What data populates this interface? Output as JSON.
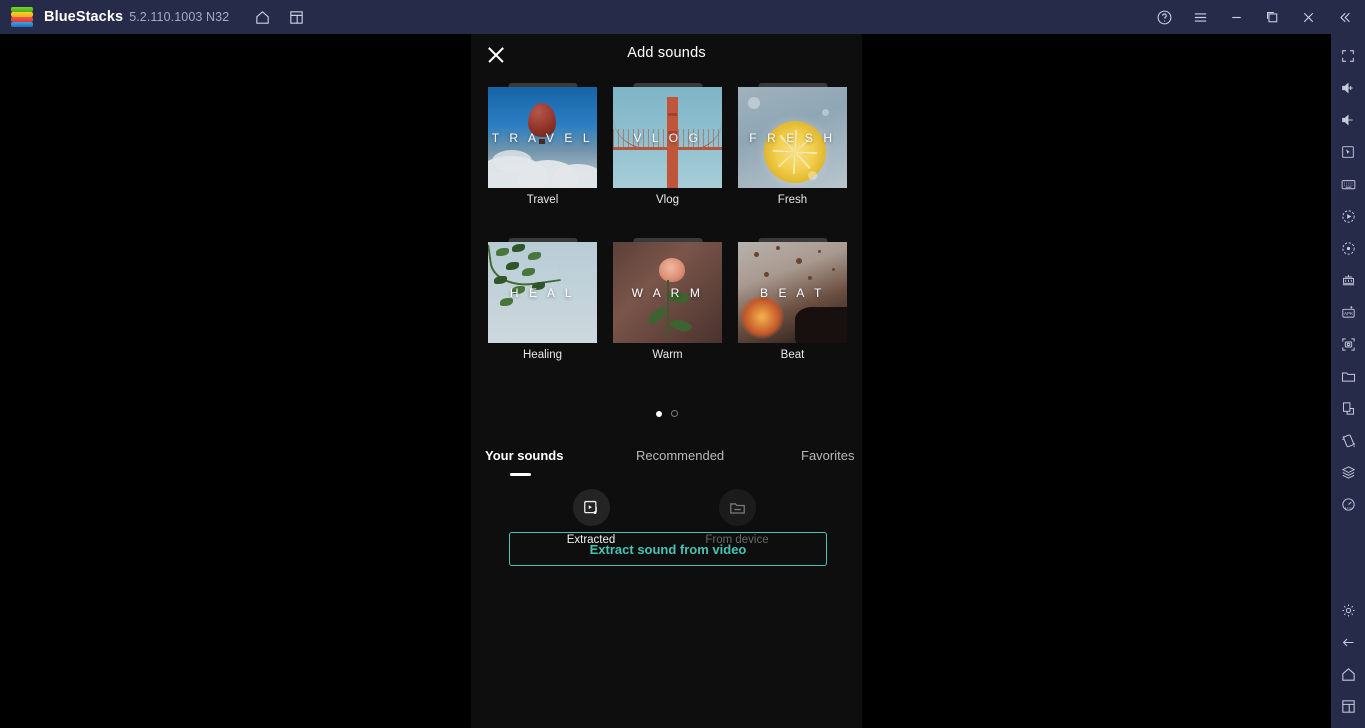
{
  "titlebar": {
    "app_name": "BlueStacks",
    "version": "5.2.110.1003 N32",
    "left_icons": [
      {
        "name": "home-icon",
        "glyph": "home"
      },
      {
        "name": "multi-instance-icon",
        "glyph": "windows"
      }
    ],
    "right_icons": [
      {
        "name": "help-icon",
        "glyph": "help"
      },
      {
        "name": "menu-icon",
        "glyph": "hamburger"
      },
      {
        "name": "minimize-icon",
        "glyph": "minimize"
      },
      {
        "name": "maximize-icon",
        "glyph": "maximize"
      },
      {
        "name": "close-icon",
        "glyph": "close"
      },
      {
        "name": "collapse-sidebar-icon",
        "glyph": "chevrons-left"
      }
    ]
  },
  "sidebar": {
    "top_items": [
      {
        "name": "fullscreen-icon",
        "label": "Fullscreen"
      },
      {
        "name": "volume-up-icon",
        "label": "Volume up"
      },
      {
        "name": "volume-down-icon",
        "label": "Volume down"
      },
      {
        "name": "cursor-icon",
        "label": "Game controls"
      },
      {
        "name": "keyboard-icon",
        "label": "Keyboard controls"
      },
      {
        "name": "record-icon",
        "label": "Record"
      },
      {
        "name": "rotate-icon",
        "label": "Rotate"
      },
      {
        "name": "multi-instance-manager-icon",
        "label": "Multi-instance manager"
      },
      {
        "name": "install-apk-icon",
        "label": "Install APK"
      },
      {
        "name": "screenshot-icon",
        "label": "Screenshot"
      },
      {
        "name": "media-folder-icon",
        "label": "Media manager"
      },
      {
        "name": "copy-paste-icon",
        "label": "Copy to clipboard"
      },
      {
        "name": "shake-icon",
        "label": "Shake"
      },
      {
        "name": "macro-icon",
        "label": "Macro recorder"
      },
      {
        "name": "performance-icon",
        "label": "Performance"
      }
    ],
    "bottom_items": [
      {
        "name": "settings-icon",
        "label": "Settings"
      },
      {
        "name": "back-icon",
        "label": "Back"
      },
      {
        "name": "home-icon",
        "label": "Home"
      },
      {
        "name": "recents-icon",
        "label": "Recents"
      }
    ]
  },
  "app": {
    "title": "Add sounds",
    "close_label": "Close",
    "categories": [
      {
        "word": "T R A V E L",
        "label": "Travel",
        "art": "art-travel"
      },
      {
        "word": "V L O G",
        "label": "Vlog",
        "art": "art-vlog"
      },
      {
        "word": "F R E S H",
        "label": "Fresh",
        "art": "art-fresh"
      },
      {
        "word": "H E A L",
        "label": "Healing",
        "art": "art-heal"
      },
      {
        "word": "W A R M",
        "label": "Warm",
        "art": "art-warm"
      },
      {
        "word": "B E A T",
        "label": "Beat",
        "art": "art-beat"
      }
    ],
    "pager": {
      "pages": 2,
      "active": 1
    },
    "tabs": [
      {
        "label": "Your sounds",
        "active": true
      },
      {
        "label": "Recommended",
        "active": false
      },
      {
        "label": "Favorites",
        "active": false
      }
    ],
    "sources": [
      {
        "label": "Extracted",
        "icon": "extracted-sound-icon",
        "enabled": true
      },
      {
        "label": "From device",
        "icon": "folder-icon",
        "enabled": false
      }
    ],
    "extract_button": "Extract sound from video"
  },
  "colors": {
    "titlebar_bg": "#252b49",
    "app_bg": "#0e0e0e",
    "stage_bg": "#000000",
    "accent_teal": "#46c3b2",
    "text_primary": "#ffffff",
    "text_muted": "#b9b9b9",
    "text_disabled": "#6a6a6a"
  }
}
